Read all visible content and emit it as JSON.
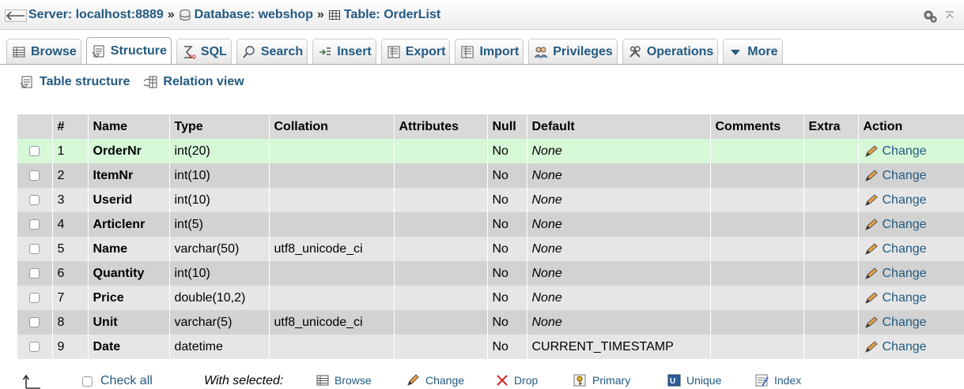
{
  "breadcrumb": {
    "server": "Server: localhost:8889",
    "separator": "»",
    "database": "Database: webshop",
    "table": "Table: OrderList"
  },
  "tabs": [
    {
      "label": "Browse",
      "icon": "browse-icon"
    },
    {
      "label": "Structure",
      "icon": "structure-icon",
      "active": true
    },
    {
      "label": "SQL",
      "icon": "sql-icon"
    },
    {
      "label": "Search",
      "icon": "search-icon"
    },
    {
      "label": "Insert",
      "icon": "insert-icon"
    },
    {
      "label": "Export",
      "icon": "export-icon"
    },
    {
      "label": "Import",
      "icon": "import-icon"
    },
    {
      "label": "Privileges",
      "icon": "privileges-icon"
    },
    {
      "label": "Operations",
      "icon": "operations-icon"
    },
    {
      "label": "More",
      "icon": "triangle-down-icon"
    }
  ],
  "subnav": {
    "table_structure": "Table structure",
    "relation_view": "Relation view"
  },
  "table": {
    "headers": {
      "num": "#",
      "name": "Name",
      "type": "Type",
      "collation": "Collation",
      "attributes": "Attributes",
      "null": "Null",
      "default": "Default",
      "comments": "Comments",
      "extra": "Extra",
      "action": "Action"
    },
    "rows": [
      {
        "num": "1",
        "name": "OrderNr",
        "type": "int(20)",
        "collation": "",
        "null": "No",
        "default": "None",
        "action": "Change"
      },
      {
        "num": "2",
        "name": "ItemNr",
        "type": "int(10)",
        "collation": "",
        "null": "No",
        "default": "None",
        "action": "Change"
      },
      {
        "num": "3",
        "name": "Userid",
        "type": "int(10)",
        "collation": "",
        "null": "No",
        "default": "None",
        "action": "Change"
      },
      {
        "num": "4",
        "name": "Articlenr",
        "type": "int(5)",
        "collation": "",
        "null": "No",
        "default": "None",
        "action": "Change"
      },
      {
        "num": "5",
        "name": "Name",
        "type": "varchar(50)",
        "collation": "utf8_unicode_ci",
        "null": "No",
        "default": "None",
        "action": "Change"
      },
      {
        "num": "6",
        "name": "Quantity",
        "type": "int(10)",
        "collation": "",
        "null": "No",
        "default": "None",
        "action": "Change"
      },
      {
        "num": "7",
        "name": "Price",
        "type": "double(10,2)",
        "collation": "",
        "null": "No",
        "default": "None",
        "action": "Change"
      },
      {
        "num": "8",
        "name": "Unit",
        "type": "varchar(5)",
        "collation": "utf8_unicode_ci",
        "null": "No",
        "default": "None",
        "action": "Change"
      },
      {
        "num": "9",
        "name": "Date",
        "type": "datetime",
        "collation": "",
        "null": "No",
        "default": "CURRENT_TIMESTAMP",
        "action": "Change"
      }
    ]
  },
  "footer": {
    "check_all": "Check all",
    "with_selected": "With selected:",
    "actions": [
      "Browse",
      "Change",
      "Drop",
      "Primary",
      "Unique",
      "Index"
    ]
  },
  "colors": {
    "link": "#235a81",
    "row_highlight": "#d7f8d7",
    "row_odd": "#e6e6e6",
    "row_even": "#d2d2d2",
    "drop_red": "#d02020"
  }
}
